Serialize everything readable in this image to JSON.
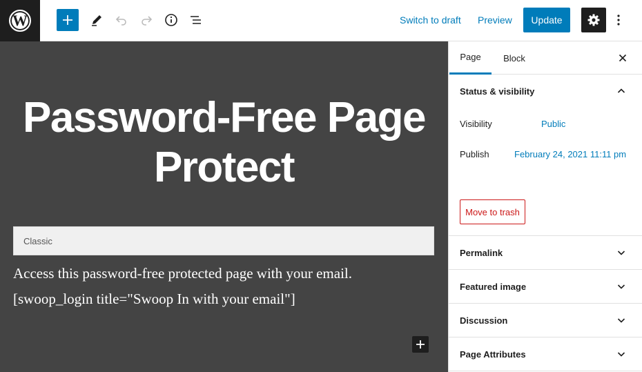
{
  "toolbar": {
    "logo_letter": "W",
    "switch_to_draft": "Switch to draft",
    "preview": "Preview",
    "update": "Update"
  },
  "editor": {
    "title_line1": "Password-Free Page",
    "title_line2": "Protect",
    "classic_label": "Classic",
    "paragraph1": "Access this password-free protected page with your email.",
    "paragraph2": "[swoop_login title=\"Swoop In with your email\"]"
  },
  "sidebar": {
    "tabs": [
      "Page",
      "Block"
    ],
    "status_panel": {
      "title": "Status & visibility",
      "visibility_label": "Visibility",
      "visibility_value": "Public",
      "publish_label": "Publish",
      "publish_value": "February 24, 2021 11:11 pm",
      "trash_label": "Move to trash"
    },
    "panels": [
      "Permalink",
      "Featured image",
      "Discussion",
      "Page Attributes"
    ]
  },
  "colors": {
    "accent": "#007cba",
    "canvas_bg": "#444444",
    "danger": "#cc1818",
    "dark": "#1e1e1e"
  }
}
